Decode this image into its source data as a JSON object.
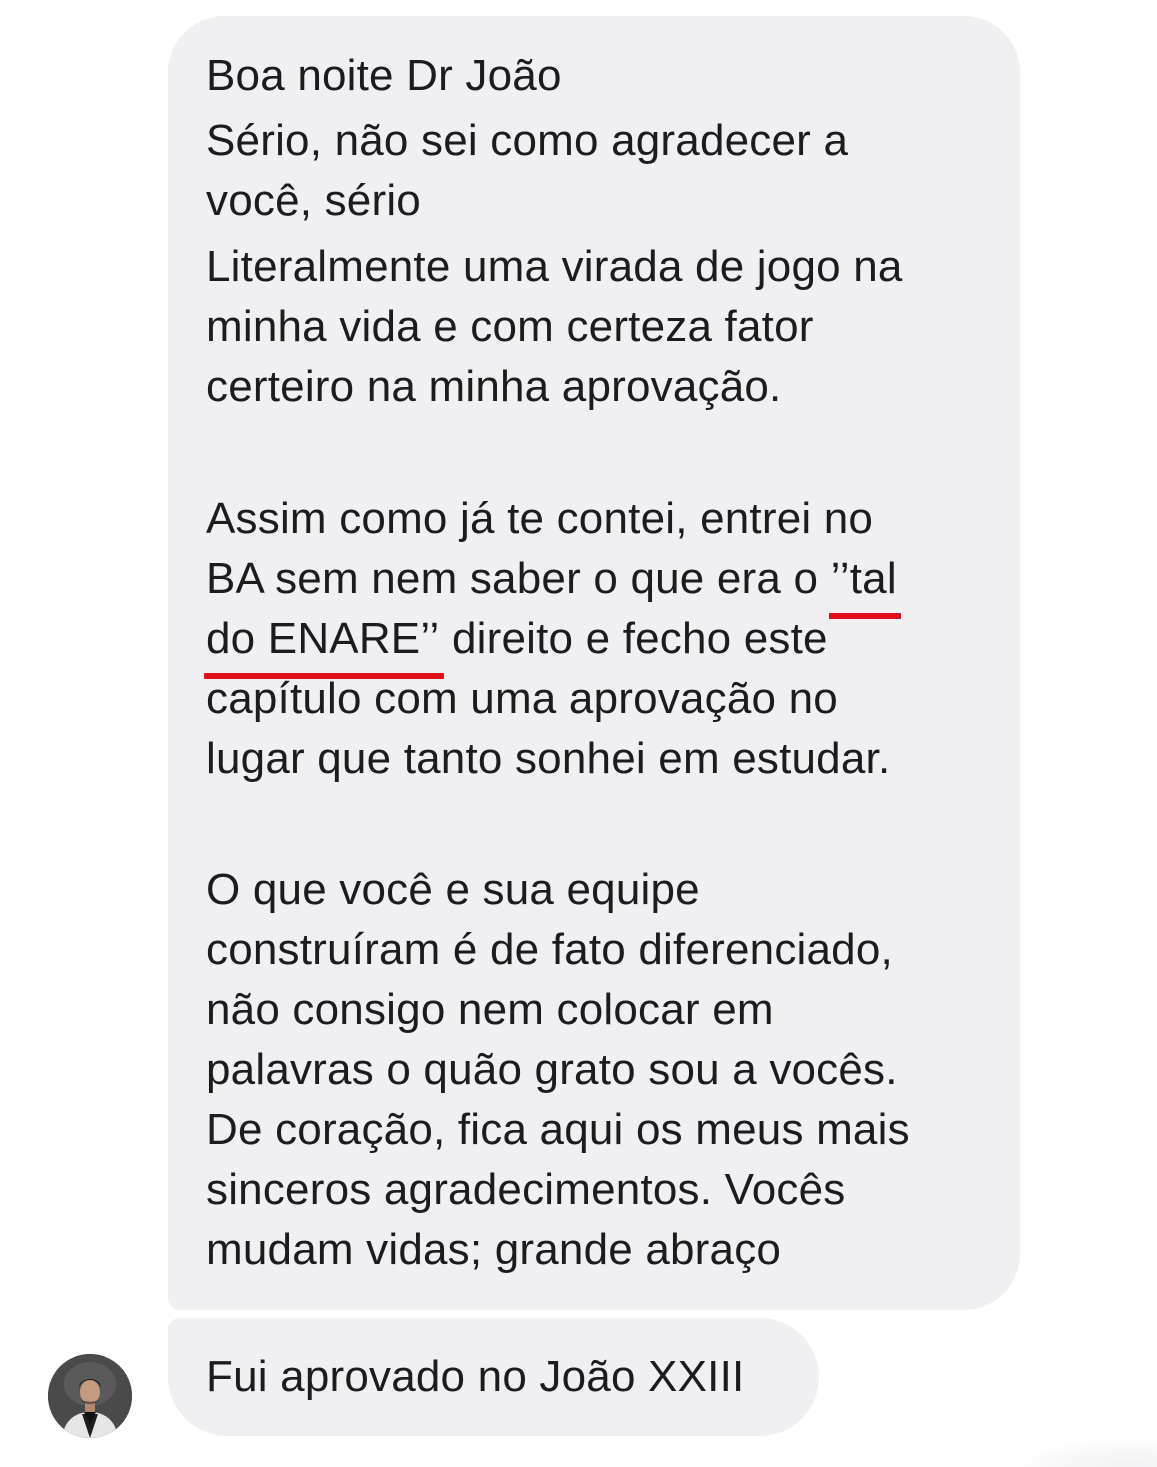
{
  "conversation": {
    "message_1": {
      "lines": [
        "Boa noite Dr João",
        "Sério, não sei como agradecer a",
        "você, sério",
        "Literalmente uma virada de jogo na",
        "minha vida e com certeza fator",
        "certeiro na minha aprovação.",
        "",
        "Assim como já te contei, entrei no",
        "BA sem nem saber o que era o ",
        "’’tal",
        "do ENARE’’",
        " direito e fecho este",
        "capítulo com uma aprovação no",
        "lugar que tanto sonhei em estudar.",
        "",
        "O que você e sua equipe",
        "construíram é de fato diferenciado,",
        "não consigo nem colocar em",
        "palavras o quão grato sou a vocês.",
        "De coração, fica aqui os meus mais",
        "sinceros agradecimentos. Vocês",
        "mudam vidas; grande abraço"
      ],
      "highlight_color": "#e0101a"
    },
    "message_2": {
      "text": "Fui aprovado no João XXIII"
    },
    "sender": {
      "avatar_icon": "profile-photo-avatar"
    },
    "bubble_color": "#f0f0f2"
  }
}
